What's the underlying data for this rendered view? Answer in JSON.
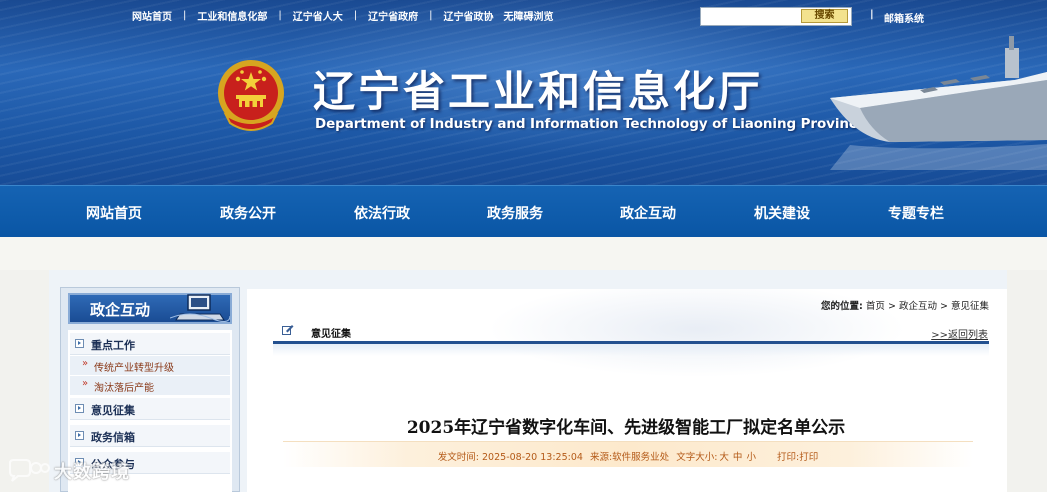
{
  "top_links": [
    "网站首页",
    "工业和信息化部",
    "辽宁省人大",
    "辽宁省政府",
    "辽宁省政协",
    "无障碍浏览"
  ],
  "search": {
    "button_label": "搜索",
    "placeholder": ""
  },
  "mail_sep": "|",
  "mail_label": "邮箱系统",
  "site_title": "辽宁省工业和信息化厅",
  "site_subtitle": "Department of Industry and Information Technology of Liaoning Province",
  "nav": [
    "网站首页",
    "政务公开",
    "依法行政",
    "政务服务",
    "政企互动",
    "机关建设",
    "专题专栏"
  ],
  "sidebar": {
    "title": "政企互动",
    "items": [
      {
        "label": "重点工作"
      },
      {
        "label": "传统产业转型升级",
        "sub": true
      },
      {
        "label": "淘汰落后产能",
        "sub": true
      },
      {
        "label": "意见征集"
      },
      {
        "label": "政务信箱"
      },
      {
        "label": "公众参与"
      }
    ],
    "sub_arrow": "»"
  },
  "breadcrumb": {
    "prefix": "您的位置:",
    "home": "首页",
    "section": "政企互动",
    "current": "意见征集",
    "sep": ">"
  },
  "section_label": "意见征集",
  "back_link": ">>返回列表",
  "article": {
    "title": "2025年辽宁省数字化车间、先进级智能工厂拟定名单公示",
    "publish_label": "发文时间:",
    "publish_time": "2025-08-20 13:25:04",
    "source_label": "来源:",
    "source": "软件服务业处",
    "font_size_label": "文字大小:",
    "font_sizes": [
      "大",
      "中",
      "小"
    ],
    "print_label": "打印:",
    "print_link": "打印"
  },
  "watermark": {
    "text": "大数跨境",
    "icon": "chat-bubble-icon"
  },
  "colors": {
    "nav_bg": "#0a56a5",
    "rule": "#23508f",
    "meta_text": "#b45a18"
  }
}
